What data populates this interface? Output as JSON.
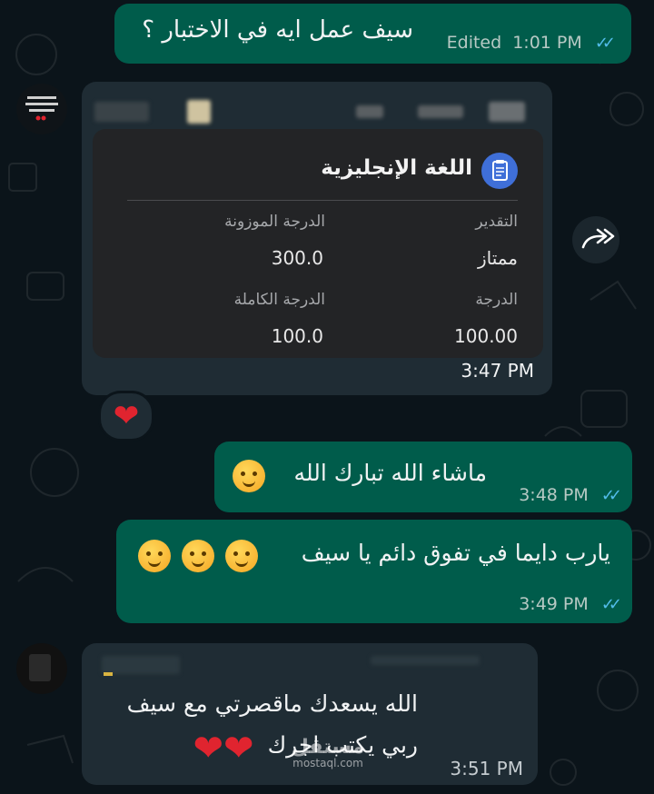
{
  "messages": {
    "m1": {
      "text": "سيف عمل ايه في الاختبار ؟",
      "edited": "Edited",
      "time": "1:01 PM"
    },
    "card": {
      "subject": "اللغة الإنجليزية",
      "labels": {
        "grade_eval": "التقدير",
        "weighted": "الدرجة الموزونة",
        "score": "الدرجة",
        "full": "الدرجة الكاملة"
      },
      "values": {
        "grade_eval": "ممتاز",
        "weighted": "300.0",
        "score": "100.00",
        "full": "100.0"
      },
      "time": "3:47 PM"
    },
    "m2": {
      "text": "ماشاء الله تبارك الله",
      "time": "3:48 PM"
    },
    "m3": {
      "text": "يارب دايما في تفوق دائم يا سيف",
      "time": "3:49 PM"
    },
    "m4": {
      "line1": "الله يسعدك ماقصرتي مع سيف",
      "line2": "ربي يكتب اجرك",
      "time": "3:51 PM"
    }
  },
  "reaction": {
    "emoji_name": "heart"
  },
  "watermark": {
    "brand": "مستقل",
    "site": "mostaql.com"
  },
  "colors": {
    "outgoing": "#005c4b",
    "incoming": "#1f2c34",
    "ticks": "#53bdeb",
    "background": "#0b141a"
  }
}
